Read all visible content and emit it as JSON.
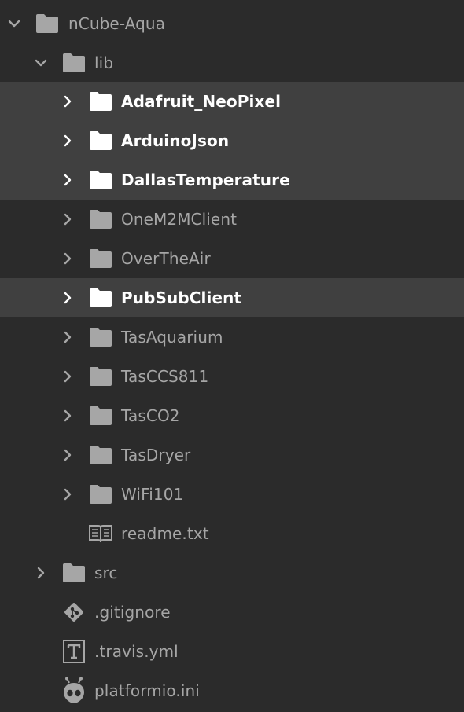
{
  "tree": {
    "root": {
      "label": "nCube-Aqua",
      "expanded": true,
      "icon": "folder-icon"
    },
    "lib": {
      "label": "lib",
      "expanded": true,
      "icon": "folder-icon"
    },
    "lib_items": [
      {
        "label": "Adafruit_NeoPixel",
        "type": "folder",
        "highlighted": true
      },
      {
        "label": "ArduinoJson",
        "type": "folder",
        "highlighted": true
      },
      {
        "label": "DallasTemperature",
        "type": "folder",
        "highlighted": true
      },
      {
        "label": "OneM2MClient",
        "type": "folder",
        "highlighted": false
      },
      {
        "label": "OverTheAir",
        "type": "folder",
        "highlighted": false
      },
      {
        "label": "PubSubClient",
        "type": "folder",
        "highlighted": true
      },
      {
        "label": "TasAquarium",
        "type": "folder",
        "highlighted": false
      },
      {
        "label": "TasCCS811",
        "type": "folder",
        "highlighted": false
      },
      {
        "label": "TasCO2",
        "type": "folder",
        "highlighted": false
      },
      {
        "label": "TasDryer",
        "type": "folder",
        "highlighted": false
      },
      {
        "label": "WiFi101",
        "type": "folder",
        "highlighted": false
      },
      {
        "label": "readme.txt",
        "type": "file",
        "icon": "book-icon"
      }
    ],
    "root_items": [
      {
        "label": "src",
        "type": "folder",
        "icon": "folder-icon"
      },
      {
        "label": ".gitignore",
        "type": "file",
        "icon": "git-icon"
      },
      {
        "label": ".travis.yml",
        "type": "file",
        "icon": "text-t-icon"
      },
      {
        "label": "platformio.ini",
        "type": "file",
        "icon": "alien-icon"
      }
    ]
  },
  "colors": {
    "background": "#2b2b2b",
    "highlight_row": "#404040",
    "text_normal": "#a6a6a6",
    "text_highlight": "#ffffff"
  }
}
